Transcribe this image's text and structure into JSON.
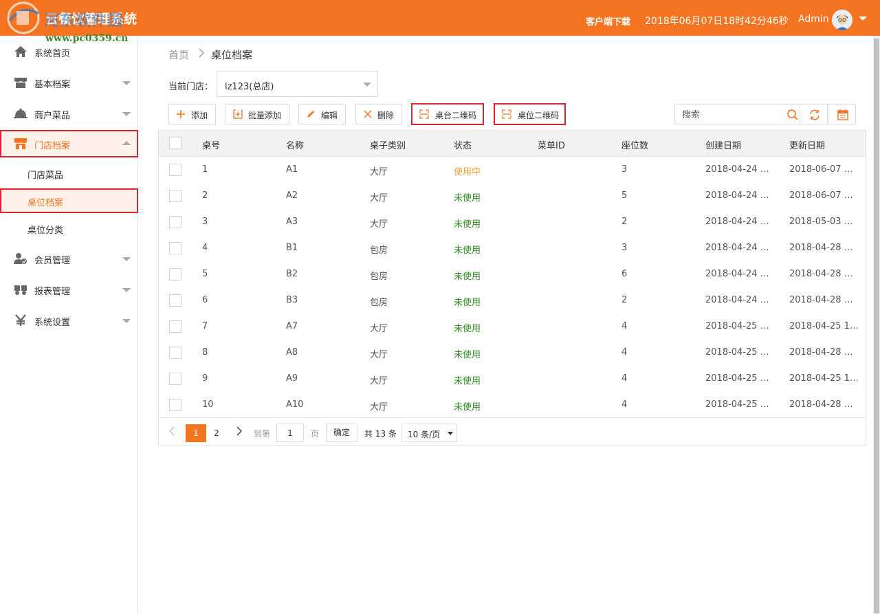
{
  "header": {
    "app_title": "云餐饮管理系统",
    "watermark_text": "河东软件园",
    "watermark_url": "www.pc0359.cn",
    "client_download": "客户端下载",
    "datetime": "2018年06月07日18时42分46秒",
    "user": "Admin"
  },
  "sidebar": {
    "items": [
      {
        "label": "系统首页",
        "icon": "home-icon"
      },
      {
        "label": "基本档案",
        "icon": "store-icon"
      },
      {
        "label": "商户菜品",
        "icon": "dish-cover-icon"
      },
      {
        "label": "门店档案",
        "icon": "shop-icon"
      },
      {
        "label": "会员管理",
        "icon": "member-icon"
      },
      {
        "label": "报表管理",
        "icon": "report-icon"
      },
      {
        "label": "系统设置",
        "icon": "yen-icon"
      }
    ],
    "sub_items": [
      {
        "label": "门店菜品"
      },
      {
        "label": "桌位档案"
      },
      {
        "label": "桌位分类"
      }
    ]
  },
  "breadcrumb": {
    "home": "首页",
    "current": "桌位档案"
  },
  "store": {
    "label": "当前门店：",
    "value": "lz123(总店)"
  },
  "toolbar": {
    "add": "添加",
    "batch_add": "批量添加",
    "edit": "编辑",
    "delete": "删除",
    "table_qr": "桌台二维码",
    "seat_qr": "桌位二维码",
    "search_placeholder": "搜索"
  },
  "table": {
    "headers": [
      "桌号",
      "名称",
      "桌子类别",
      "状态",
      "菜单ID",
      "座位数",
      "创建日期",
      "更新日期"
    ],
    "rows": [
      {
        "no": "1",
        "name": "A1",
        "type": "大厅",
        "status": "使用中",
        "menu": "",
        "seats": "3",
        "created": "2018-04-24 …",
        "updated": "2018-06-07 …"
      },
      {
        "no": "2",
        "name": "A2",
        "type": "大厅",
        "status": "未使用",
        "menu": "",
        "seats": "5",
        "created": "2018-04-24 …",
        "updated": "2018-06-07 …"
      },
      {
        "no": "3",
        "name": "A3",
        "type": "大厅",
        "status": "未使用",
        "menu": "",
        "seats": "2",
        "created": "2018-04-24 …",
        "updated": "2018-05-03 …"
      },
      {
        "no": "4",
        "name": "B1",
        "type": "包房",
        "status": "未使用",
        "menu": "",
        "seats": "3",
        "created": "2018-04-24 …",
        "updated": "2018-04-28 …"
      },
      {
        "no": "5",
        "name": "B2",
        "type": "包房",
        "status": "未使用",
        "menu": "",
        "seats": "6",
        "created": "2018-04-24 …",
        "updated": "2018-04-28 …"
      },
      {
        "no": "6",
        "name": "B3",
        "type": "包房",
        "status": "未使用",
        "menu": "",
        "seats": "2",
        "created": "2018-04-24 …",
        "updated": "2018-04-28 …"
      },
      {
        "no": "7",
        "name": "A7",
        "type": "大厅",
        "status": "未使用",
        "menu": "",
        "seats": "4",
        "created": "2018-04-25 …",
        "updated": "2018-04-25 1…"
      },
      {
        "no": "8",
        "name": "A8",
        "type": "大厅",
        "status": "未使用",
        "menu": "",
        "seats": "4",
        "created": "2018-04-25 …",
        "updated": "2018-04-28 …"
      },
      {
        "no": "9",
        "name": "A9",
        "type": "大厅",
        "status": "未使用",
        "menu": "",
        "seats": "4",
        "created": "2018-04-25 …",
        "updated": "2018-04-25 1…"
      },
      {
        "no": "10",
        "name": "A10",
        "type": "大厅",
        "status": "未使用",
        "menu": "",
        "seats": "4",
        "created": "2018-04-25 …",
        "updated": "2018-04-28 …"
      }
    ]
  },
  "pager": {
    "pages": [
      "1",
      "2"
    ],
    "goto_label": "到第",
    "goto_value": "1",
    "page_unit": "页",
    "confirm": "确定",
    "total": "共 13 条",
    "page_size": "10 条/页"
  },
  "colors": {
    "accent": "#f57421",
    "highlight_border": "#e0232a",
    "in_use": "#f0a030",
    "unused": "#2d8a1f"
  }
}
